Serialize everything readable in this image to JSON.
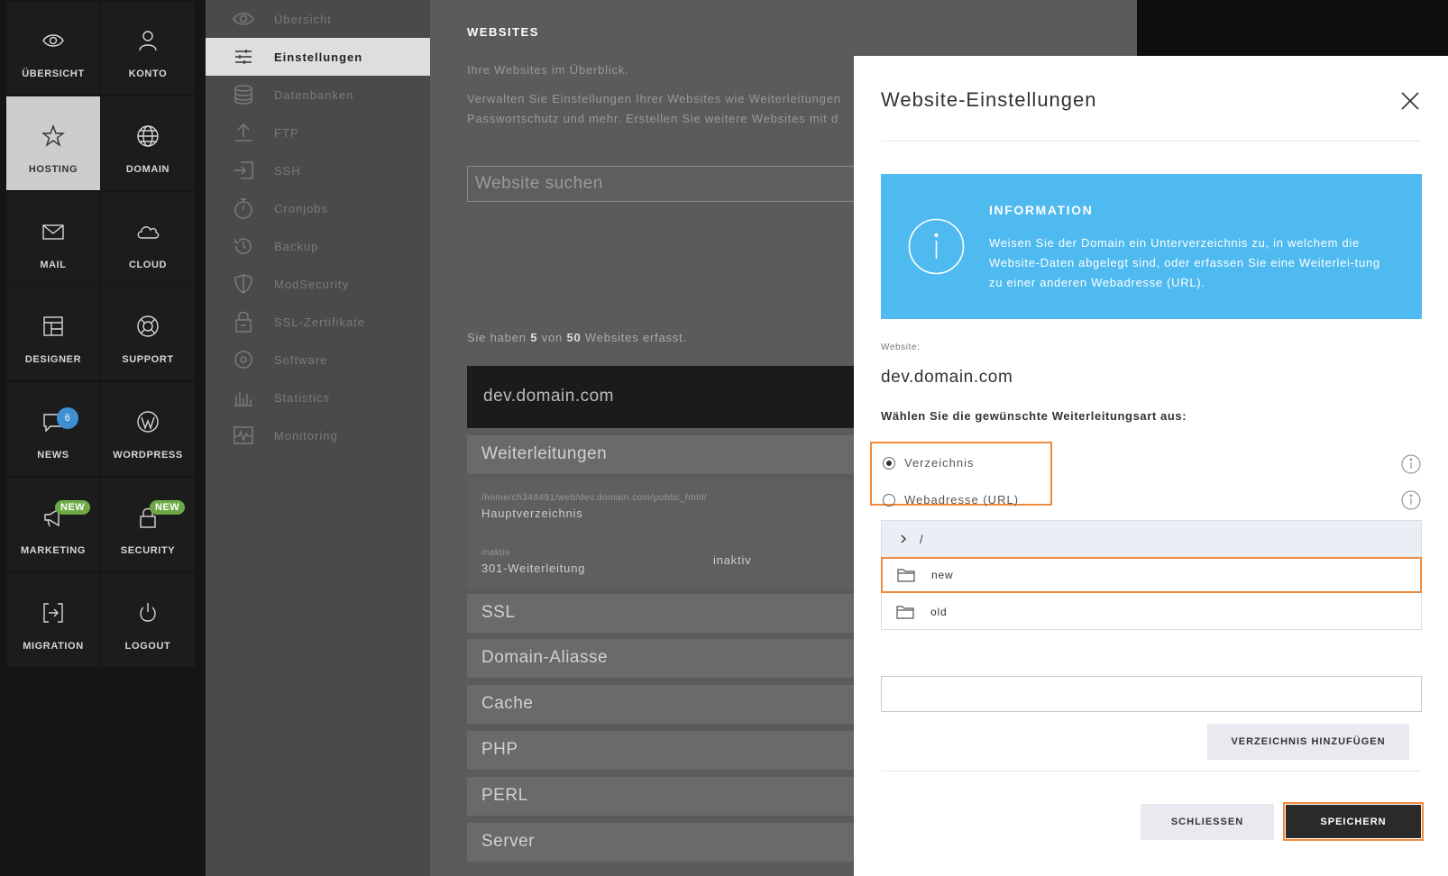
{
  "tilenav": {
    "items": [
      {
        "label": "ÜBERSICHT",
        "icon": "eye-icon"
      },
      {
        "label": "KONTO",
        "icon": "user-icon"
      },
      {
        "label": "HOSTING",
        "icon": "star-icon",
        "active": true
      },
      {
        "label": "DOMAIN",
        "icon": "globe-icon"
      },
      {
        "label": "MAIL",
        "icon": "envelope-icon"
      },
      {
        "label": "CLOUD",
        "icon": "cloud-icon"
      },
      {
        "label": "DESIGNER",
        "icon": "layout-icon"
      },
      {
        "label": "SUPPORT",
        "icon": "lifebuoy-icon"
      },
      {
        "label": "NEWS",
        "icon": "speech-bubble-icon",
        "badge": "6"
      },
      {
        "label": "WORDPRESS",
        "icon": "wordpress-icon"
      },
      {
        "label": "MARKETING",
        "icon": "megaphone-icon",
        "badge": "NEW"
      },
      {
        "label": "SECURITY",
        "icon": "lock-icon",
        "badge": "NEW"
      },
      {
        "label": "MIGRATION",
        "icon": "migration-icon"
      },
      {
        "label": "LOGOUT",
        "icon": "power-icon"
      }
    ]
  },
  "subnav": {
    "items": [
      {
        "label": "Übersicht",
        "icon": "eye-icon"
      },
      {
        "label": "Einstellungen",
        "icon": "sliders-icon",
        "active": true
      },
      {
        "label": "Datenbanken",
        "icon": "database-icon"
      },
      {
        "label": "FTP",
        "icon": "upload-icon"
      },
      {
        "label": "SSH",
        "icon": "terminal-icon"
      },
      {
        "label": "Cronjobs",
        "icon": "stopwatch-icon"
      },
      {
        "label": "Backup",
        "icon": "history-icon"
      },
      {
        "label": "ModSecurity",
        "icon": "shield-icon"
      },
      {
        "label": "SSL-Zertifikate",
        "icon": "certificate-lock-icon"
      },
      {
        "label": "Software",
        "icon": "disc-icon"
      },
      {
        "label": "Statistics",
        "icon": "bar-chart-icon"
      },
      {
        "label": "Monitoring",
        "icon": "pulse-icon"
      }
    ]
  },
  "main": {
    "heading": "WEBSITES",
    "intro": "Ihre Websites im Überblick.",
    "desc_line1": "Verwalten Sie Einstellungen Ihrer Websites wie Weiterleitungen",
    "desc_line2": "Passwortschutz und mehr. Erstellen Sie weitere Websites mit d",
    "search_placeholder": "Website suchen",
    "counter_prefix": "Sie haben",
    "counter_count": "5",
    "counter_mid": "von",
    "counter_total": "50",
    "counter_suffix": "Websites erfasst.",
    "domain": "dev.domain.com",
    "section_redirects": "Weiterleitungen",
    "row1_path": "/home/ch349491/web/dev.domain.com/public_html/",
    "row1_label": "Hauptverzeichnis",
    "row2_small": "inaktiv",
    "row2_label": "301-Weiterleitung",
    "row2_status": "inaktiv",
    "sections": [
      "SSL",
      "Domain-Aliasse",
      "Cache",
      "PHP",
      "PERL",
      "Server"
    ]
  },
  "modal": {
    "title": "Website-Einstellungen",
    "info_title": "INFORMATION",
    "info_text": "Weisen Sie der Domain ein Unterverzeichnis zu, in welchem die Website-Daten abgelegt sind, oder erfassen Sie eine Weiterlei-tung zu einer anderen Webadresse (URL).",
    "website_label": "Website:",
    "website_value": "dev.domain.com",
    "question": "Wählen Sie die gewünschte Weiterleitungsart aus:",
    "option_directory": "Verzeichnis",
    "option_url": "Webadresse (URL)",
    "selected_option": "Verzeichnis",
    "tree_root": "/",
    "tree_items": [
      "new",
      "old"
    ],
    "selected_folder": "new",
    "new_dir_value": "",
    "add_dir_button": "VERZEICHNIS HINZUFÜGEN",
    "close_button": "SCHLIESSEN",
    "save_button": "SPEICHERN",
    "highlight_color": "#f08a3c",
    "info_color": "#4fbaef"
  }
}
